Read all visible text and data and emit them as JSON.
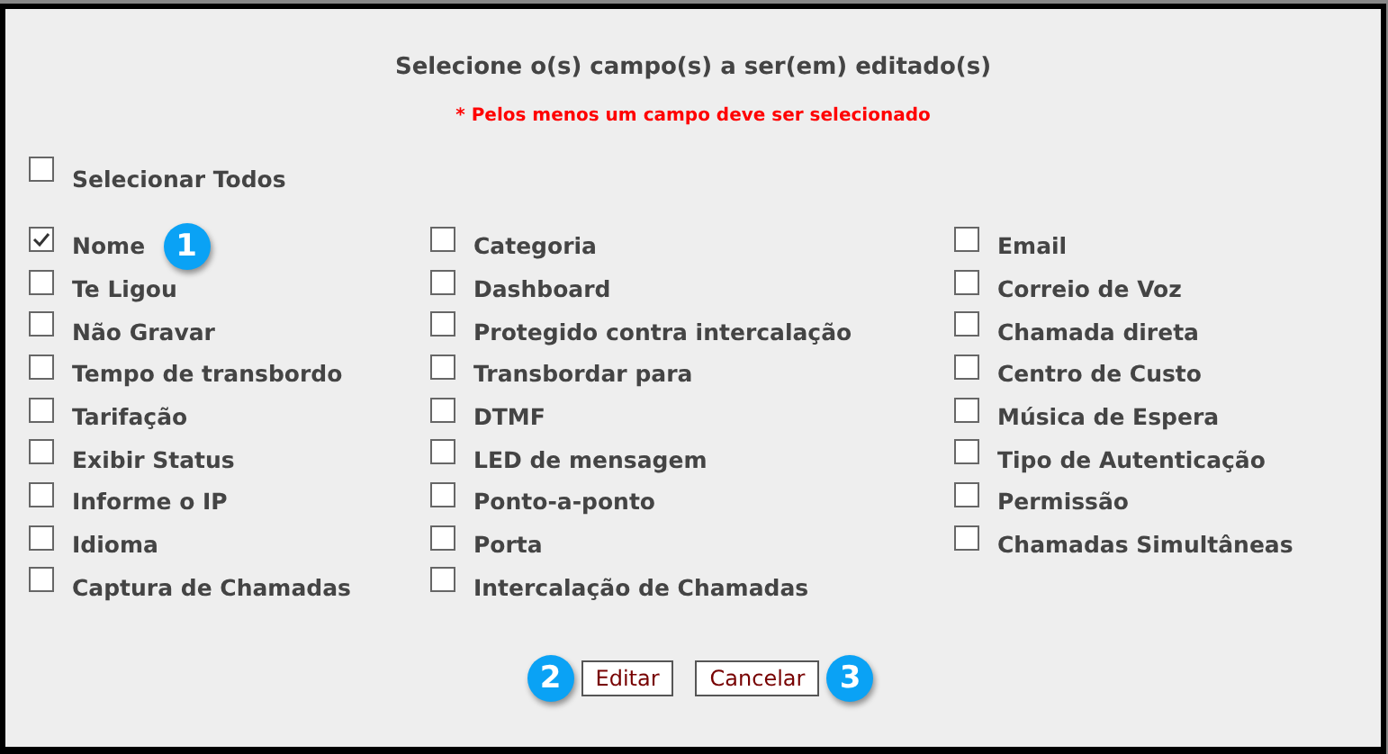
{
  "title": "Selecione o(s) campo(s) a ser(em) editado(s)",
  "warning": "* Pelos menos um campo deve ser selecionado",
  "select_all": {
    "label": "Selecionar Todos",
    "checked": false
  },
  "columns": [
    [
      {
        "label": "Nome",
        "checked": true,
        "badge": "1"
      },
      {
        "label": "Te Ligou",
        "checked": false
      },
      {
        "label": "Não Gravar",
        "checked": false
      },
      {
        "label": "Tempo de transbordo",
        "checked": false
      },
      {
        "label": "Tarifação",
        "checked": false
      },
      {
        "label": "Exibir Status",
        "checked": false
      },
      {
        "label": "Informe o IP",
        "checked": false
      },
      {
        "label": "Idioma",
        "checked": false
      },
      {
        "label": "Captura de Chamadas",
        "checked": false
      }
    ],
    [
      {
        "label": "Categoria",
        "checked": false
      },
      {
        "label": "Dashboard",
        "checked": false
      },
      {
        "label": "Protegido contra intercalação",
        "checked": false
      },
      {
        "label": "Transbordar para",
        "checked": false
      },
      {
        "label": "DTMF",
        "checked": false
      },
      {
        "label": "LED de mensagem",
        "checked": false
      },
      {
        "label": "Ponto-a-ponto",
        "checked": false
      },
      {
        "label": "Porta",
        "checked": false
      },
      {
        "label": "Intercalação de Chamadas",
        "checked": false
      }
    ],
    [
      {
        "label": "Email",
        "checked": false
      },
      {
        "label": "Correio de Voz",
        "checked": false
      },
      {
        "label": "Chamada direta",
        "checked": false
      },
      {
        "label": "Centro de Custo",
        "checked": false
      },
      {
        "label": "Música de Espera",
        "checked": false
      },
      {
        "label": "Tipo de Autenticação",
        "checked": false
      },
      {
        "label": "Permissão",
        "checked": false
      },
      {
        "label": "Chamadas Simultâneas",
        "checked": false
      }
    ]
  ],
  "buttons": [
    {
      "label": "Editar",
      "badge_before": "2"
    },
    {
      "label": "Cancelar",
      "badge_after": "3"
    }
  ]
}
